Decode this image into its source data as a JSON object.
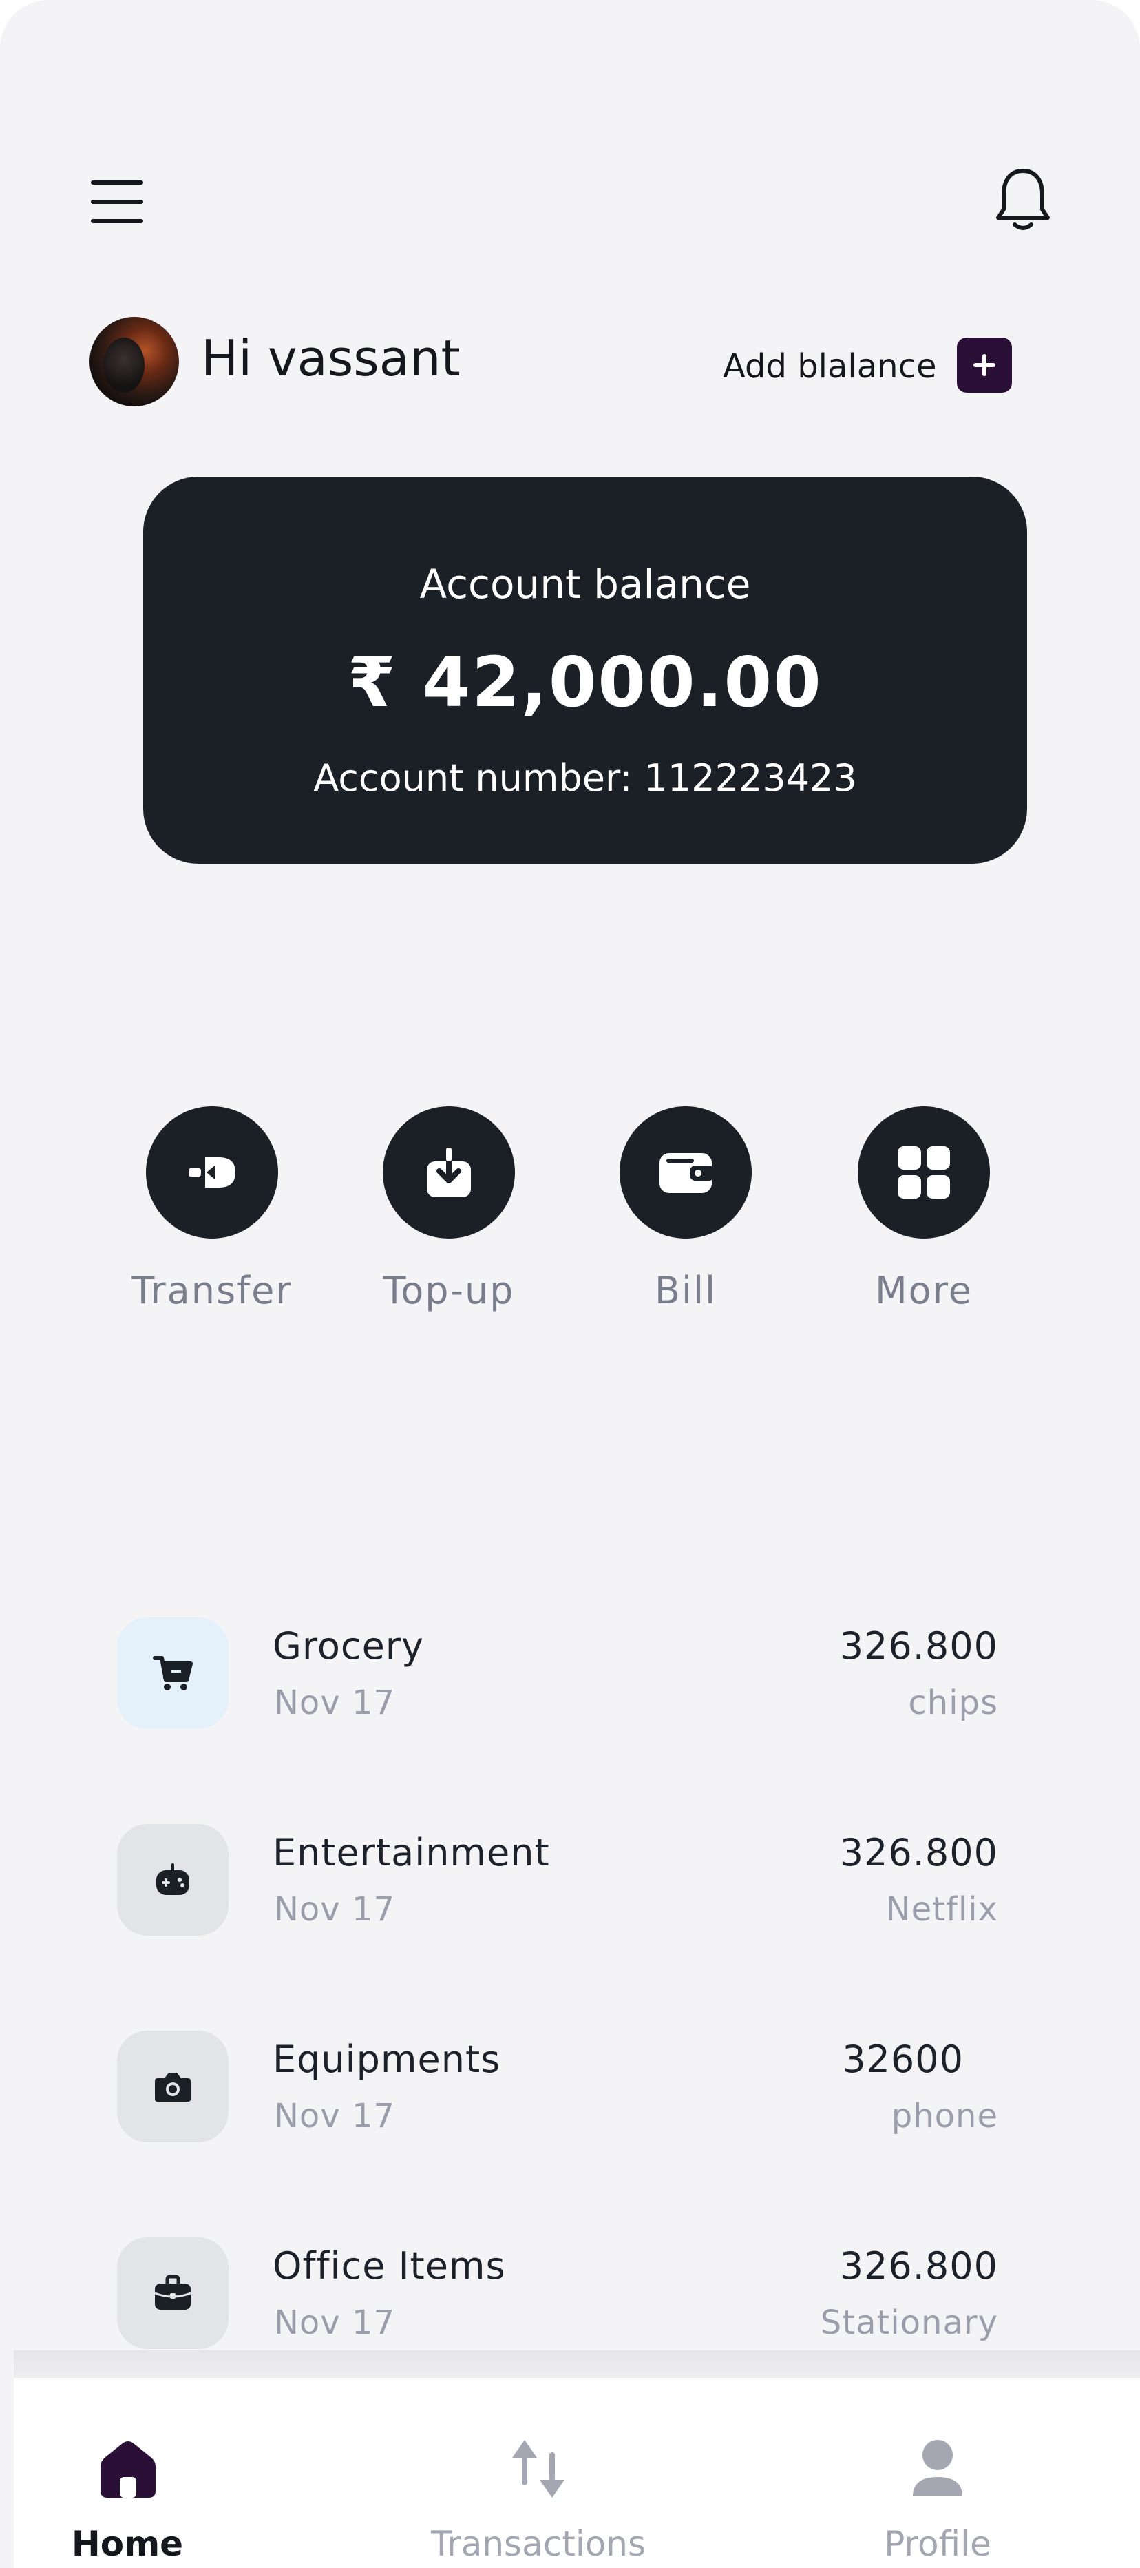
{
  "header": {
    "menu_icon": "hamburger-menu-icon",
    "notification_icon": "bell-icon"
  },
  "greeting": {
    "text": "Hi vassant",
    "add_balance_label": "Add blalance",
    "add_balance_icon": "plus-icon"
  },
  "balance_card": {
    "title": "Account balance",
    "amount": "₹ 42,000.00",
    "account_number": "Account number: 112223423"
  },
  "actions": [
    {
      "label": "Transfer",
      "icon": "transfer-icon"
    },
    {
      "label": "Top-up",
      "icon": "download-icon"
    },
    {
      "label": "Bill",
      "icon": "wallet-icon"
    },
    {
      "label": "More",
      "icon": "grid-icon"
    }
  ],
  "transactions": [
    {
      "name": "Grocery",
      "date": "Nov 17",
      "amount": "326.800",
      "note": "chips",
      "icon": "cart-icon"
    },
    {
      "name": "Entertainment",
      "date": "Nov 17",
      "amount": "326.800",
      "note": "Netflix",
      "icon": "gamepad-icon"
    },
    {
      "name": "Equipments",
      "date": "Nov 17",
      "amount": "32600",
      "note": "phone",
      "icon": "camera-icon"
    },
    {
      "name": "Office Items",
      "date": "Nov 17",
      "amount": "326.800",
      "note": "Stationary",
      "icon": "briefcase-icon"
    }
  ],
  "bottom_nav": [
    {
      "label": "Home",
      "icon": "home-icon",
      "active": true
    },
    {
      "label": "Transactions",
      "icon": "transactions-icon",
      "active": false
    },
    {
      "label": "Profile",
      "icon": "profile-icon",
      "active": false
    }
  ],
  "colors": {
    "background": "#f4f4f7",
    "card": "#1b1f26",
    "accent": "#2a0f36",
    "muted_text": "#9b9dab"
  }
}
